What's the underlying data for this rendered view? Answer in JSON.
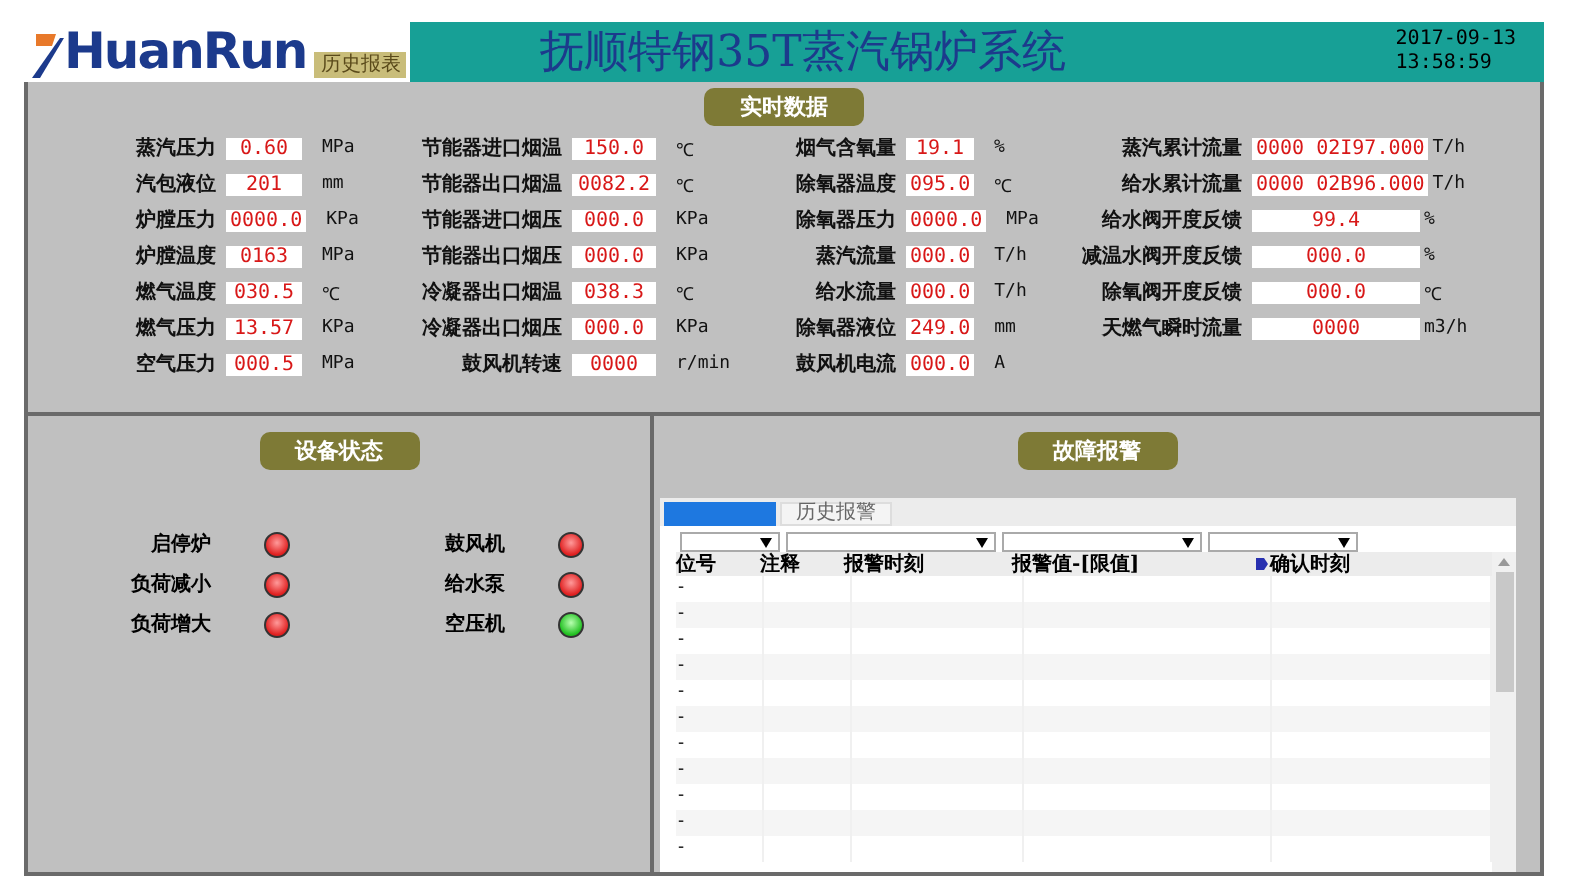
{
  "header": {
    "logo": "HuanRun",
    "report_button": "历史报表",
    "title": "抚顺特钢35T蒸汽锅炉系统",
    "date": "2017-09-13",
    "time": "13:58:59"
  },
  "realtime": {
    "title": "实时数据",
    "groups": [
      {
        "rows": [
          {
            "label": "蒸汽压力",
            "value": "0.60",
            "unit": "MPa"
          },
          {
            "label": "汽包液位",
            "value": "201",
            "unit": "mm"
          },
          {
            "label": "炉膛压力",
            "value": "0000.0",
            "unit": "KPa"
          },
          {
            "label": "炉膛温度",
            "value": "0163",
            "unit": "MPa"
          },
          {
            "label": "燃气温度",
            "value": "030.5",
            "unit": "℃"
          },
          {
            "label": "燃气压力",
            "value": "13.57",
            "unit": "KPa"
          },
          {
            "label": "空气压力",
            "value": "000.5",
            "unit": "MPa"
          }
        ]
      },
      {
        "rows": [
          {
            "label": "节能器进口烟温",
            "value": "150.0",
            "unit": "℃"
          },
          {
            "label": "节能器出口烟温",
            "value": "0082.2",
            "unit": "℃"
          },
          {
            "label": "节能器进口烟压",
            "value": "000.0",
            "unit": "KPa"
          },
          {
            "label": "节能器出口烟压",
            "value": "000.0",
            "unit": "KPa"
          },
          {
            "label": "冷凝器出口烟温",
            "value": "038.3",
            "unit": "℃"
          },
          {
            "label": "冷凝器出口烟压",
            "value": "000.0",
            "unit": "KPa"
          },
          {
            "label": "鼓风机转速",
            "value": "0000",
            "unit": "r/min"
          }
        ]
      },
      {
        "rows": [
          {
            "label": "烟气含氧量",
            "value": "19.1",
            "unit": "%"
          },
          {
            "label": "除氧器温度",
            "value": "095.0",
            "unit": "℃"
          },
          {
            "label": "除氧器压力",
            "value": "0000.0",
            "unit": "MPa"
          },
          {
            "label": "蒸汽流量",
            "value": "000.0",
            "unit": "T/h"
          },
          {
            "label": "给水流量",
            "value": "000.0",
            "unit": "T/h"
          },
          {
            "label": "除氧器液位",
            "value": "249.0",
            "unit": "mm"
          },
          {
            "label": "鼓风机电流",
            "value": "000.0",
            "unit": "A"
          }
        ]
      },
      {
        "rows": [
          {
            "label": "蒸汽累计流量",
            "value": "0000 02I97.000",
            "unit": "T/h"
          },
          {
            "label": "给水累计流量",
            "value": "0000 02B96.000",
            "unit": "T/h"
          },
          {
            "label": "给水阀开度反馈",
            "value": "99.4",
            "unit": "%"
          },
          {
            "label": "减温水阀开度反馈",
            "value": "000.0",
            "unit": "%"
          },
          {
            "label": "除氧阀开度反馈",
            "value": "000.0",
            "unit": "℃"
          },
          {
            "label": "天燃气瞬时流量",
            "value": "0000",
            "unit": "m3/h"
          }
        ]
      }
    ]
  },
  "equipment": {
    "title": "设备状态",
    "columns": [
      [
        {
          "label": "启停炉",
          "on": false
        },
        {
          "label": "负荷减小",
          "on": false
        },
        {
          "label": "负荷增大",
          "on": false
        }
      ],
      [
        {
          "label": "鼓风机",
          "on": false
        },
        {
          "label": "给水泵",
          "on": false
        },
        {
          "label": "空压机",
          "on": true
        }
      ]
    ]
  },
  "alarms": {
    "title": "故障报警",
    "tabs": [
      {
        "selected": true
      },
      {
        "label": "历史报警",
        "selected": false
      }
    ],
    "filters": [
      {
        "kind": "dropdown"
      },
      {
        "kind": "dropdown"
      },
      {
        "kind": "dropdown"
      },
      {
        "kind": "dropdown"
      }
    ],
    "columns": [
      "位号",
      "注释",
      "报警时刻",
      "报警值-[限值]",
      "确认时刻"
    ],
    "rows": [
      {
        "tag": "-"
      },
      {
        "tag": "-"
      },
      {
        "tag": "-"
      },
      {
        "tag": "-"
      },
      {
        "tag": "-"
      },
      {
        "tag": "-"
      },
      {
        "tag": "-"
      },
      {
        "tag": "-"
      },
      {
        "tag": "-"
      },
      {
        "tag": "-"
      },
      {
        "tag": "-"
      }
    ]
  }
}
